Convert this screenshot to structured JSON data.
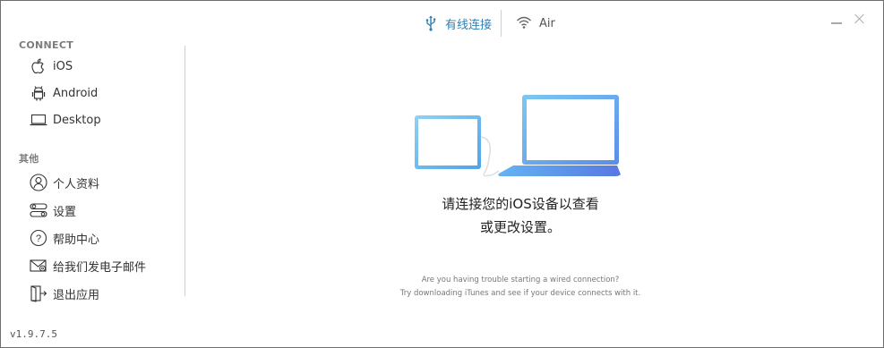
{
  "tabs": {
    "wired_label": "有线连接",
    "air_label": "Air"
  },
  "sidebar": {
    "connect_title": "CONNECT",
    "connect_items": [
      {
        "label": "iOS",
        "icon": "apple-icon"
      },
      {
        "label": "Android",
        "icon": "android-icon"
      },
      {
        "label": "Desktop",
        "icon": "laptop-icon"
      }
    ],
    "other_title": "其他",
    "other_items": [
      {
        "label": "个人资料",
        "icon": "user-icon"
      },
      {
        "label": "设置",
        "icon": "toggle-icon"
      },
      {
        "label": "帮助中心",
        "icon": "help-icon"
      },
      {
        "label": "给我们发电子邮件",
        "icon": "mail-icon"
      },
      {
        "label": "退出应用",
        "icon": "exit-icon"
      }
    ]
  },
  "version": "v1.9.7.5",
  "main": {
    "message_line1": "请连接您的iOS设备以查看",
    "message_line2": "或更改设置。",
    "hint_line1": "Are you having trouble starting a wired connection?",
    "hint_line2": "Try downloading iTunes and see if your device connects with it."
  },
  "colors": {
    "accent": "#2d7fb3",
    "device_blue": "#5aa6ef",
    "screen_border": "#7fc6ec"
  }
}
